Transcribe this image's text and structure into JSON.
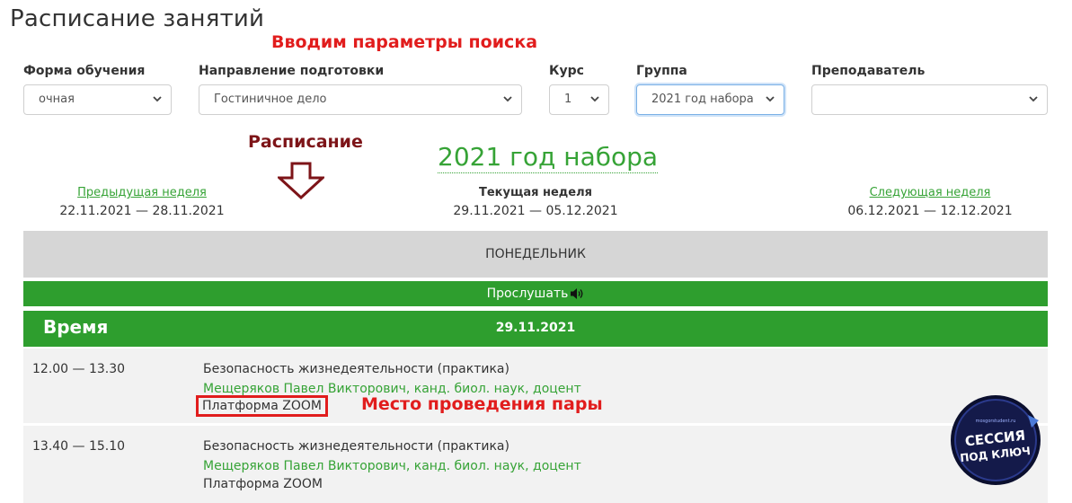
{
  "page": {
    "title": "Расписание занятий"
  },
  "annotations": {
    "search_params": "Вводим параметры поиска",
    "schedule": "Расписание",
    "lesson_place": "Место проведения пары"
  },
  "filters": [
    {
      "label": "Форма обучения",
      "value": "очная"
    },
    {
      "label": "Направление подготовки",
      "value": "Гостиничное дело"
    },
    {
      "label": "Курс",
      "value": "1"
    },
    {
      "label": "Группа",
      "value": "2021 год набора"
    },
    {
      "label": "Преподаватель",
      "value": ""
    }
  ],
  "group_heading": "2021 год набора",
  "weeks": {
    "previous": {
      "label": "Предыдущая неделя",
      "dates": "22.11.2021 — 28.11.2021"
    },
    "current": {
      "label": "Текущая неделя",
      "dates": "29.11.2021 — 05.12.2021"
    },
    "next": {
      "label": "Следующая неделя",
      "dates": "06.12.2021 — 12.12.2021"
    }
  },
  "day": {
    "name": "ПОНЕДЕЛЬНИК",
    "listen_label": "Прослушать",
    "time_header": "Время",
    "date": "29.11.2021"
  },
  "lessons": [
    {
      "time": "12.00 — 13.30",
      "subject": "Безопасность жизнедеятельности (практика)",
      "teacher": "Мещеряков Павел Викторович, канд. биол. наук, доцент",
      "place": "Платформа ZOOM"
    },
    {
      "time": "13.40 — 15.10",
      "subject": "Безопасность жизнедеятельности (практика)",
      "teacher": "Мещеряков Павел Викторович, канд. биол. наук, доцент",
      "place": "Платформа ZOOM"
    }
  ],
  "logo": {
    "line1": "СЕССИЯ",
    "line2": "ПОД КЛЮЧ",
    "small": "mosgorstudent.ru"
  },
  "colors": {
    "green": "#2e9e2e",
    "link_green": "#36a336",
    "annotation_red": "#e11d1d",
    "annotation_dark_red": "#7d1418",
    "day_bar": "#d6d6d6",
    "row_bg": "#f2f2f2"
  },
  "icons": {
    "select_arrow": "chevron-down-icon",
    "listen": "speaker-icon",
    "schedule_arrow": "arrow-down-icon"
  }
}
